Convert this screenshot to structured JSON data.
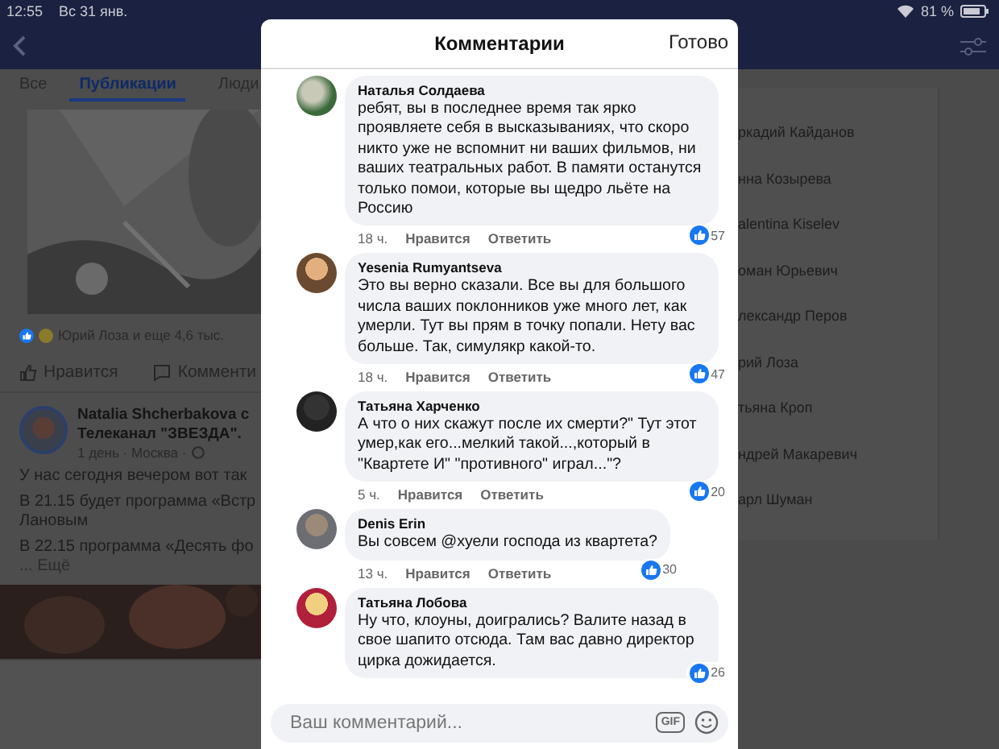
{
  "status_bar": {
    "time": "12:55",
    "date": "Вс 31 янв.",
    "battery": "81 %"
  },
  "tabs": [
    {
      "label": "Все",
      "selected": false
    },
    {
      "label": "Публикации",
      "selected": true
    },
    {
      "label": "Люди",
      "selected": false
    }
  ],
  "post_reactions": "Юрий Лоза и еще 4,6 тыс.",
  "post_actions": [
    "Нравится",
    "Комменти"
  ],
  "post": {
    "author": "Natalia Shcherbakova с",
    "page": "Телеканал \"ЗВЕЗДА\".",
    "meta": "1 день · Москва ·",
    "paragraphs": [
      "У нас сегодня вечером вот так",
      "В 21.15 будет программа «Встр Лановым",
      "В 22.15 программа «Десять фо"
    ],
    "more": "... Ещё"
  },
  "people": [
    "ркадий Кайданов",
    "нна Козырева",
    "alentina Kiselev",
    "оман Юрьевич",
    "лександр Перов",
    "рий Лоза",
    "тьяна Кроп",
    "ндрей Макаревич",
    "арл Шуман"
  ],
  "modal": {
    "title": "Комментарии",
    "done": "Готово",
    "placeholder": "Ваш комментарий...",
    "gif": "GIF",
    "comments": [
      {
        "author": "Наталья Солдаева",
        "text": "ребят, вы в последнее время так ярко проявляете себя в высказываниях, что скоро никто уже не вспомнит ни ваших фильмов, ни ваших театральных работ. В памяти останутся только помои, которые вы щедро льёте на Россию",
        "time": "18 ч.",
        "like": "Нравится",
        "reply": "Ответить",
        "likes": "57"
      },
      {
        "author": "Yesenia Rumyantseva",
        "text": "Это вы верно сказали. Все вы для большого числа ваших поклонников уже много лет, как умерли. Тут вы прям в точку попали. Нету вас больше. Так, симулякр какой-то.",
        "time": "18 ч.",
        "like": "Нравится",
        "reply": "Ответить",
        "likes": "47"
      },
      {
        "author": "Татьяна Харченко",
        "text": "А что о них скажут после их смерти?\" Тут этот умер,как его...мелкий такой...,который в \"Квартете И\" \"противного\" играл...\"?",
        "time": "5 ч.",
        "like": "Нравится",
        "reply": "Ответить",
        "likes": "20"
      },
      {
        "author": "Denis Erin",
        "text": "Вы совсем @хуели господа из квартета?",
        "time": "13 ч.",
        "like": "Нравится",
        "reply": "Ответить",
        "likes": "30"
      },
      {
        "author": "Татьяна Лобова",
        "text": "Ну что, клоуны, доигрались? Валите назад в свое шапито отсюда. Там вас давно директор цирка дожидается.",
        "likes": "26"
      }
    ]
  }
}
